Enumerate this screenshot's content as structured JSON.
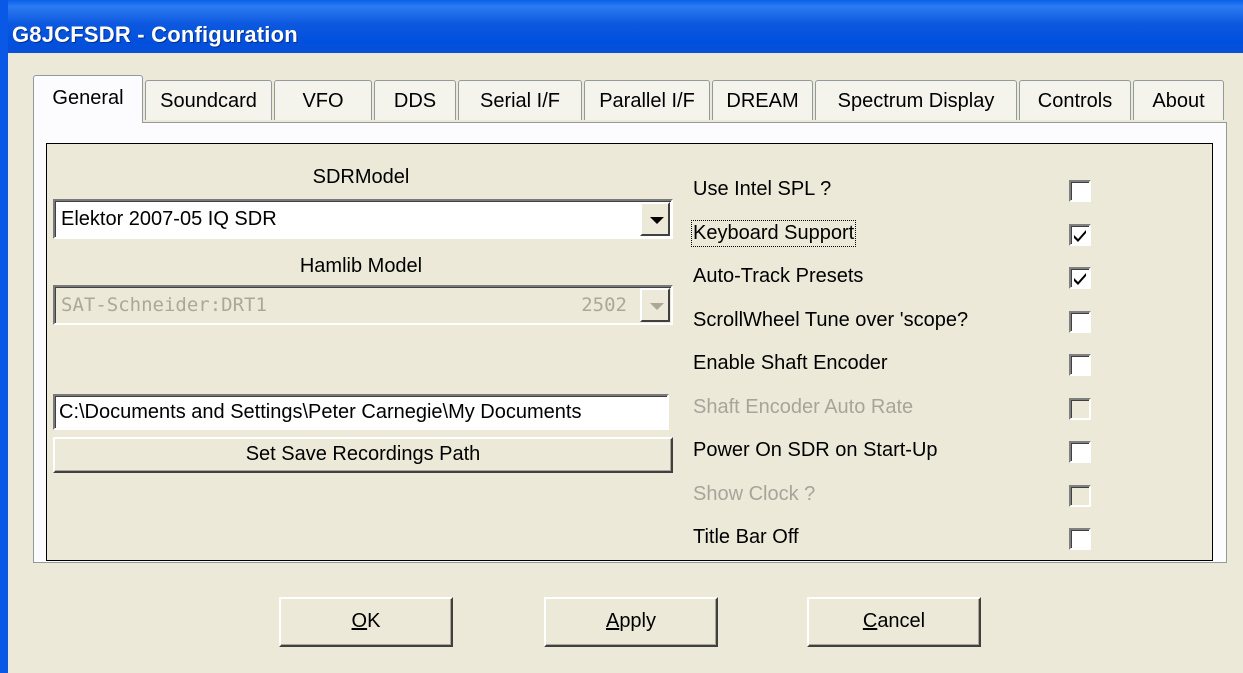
{
  "window": {
    "title": "G8JCFSDR - Configuration"
  },
  "tabs": [
    {
      "label": "General",
      "active": true
    },
    {
      "label": "Soundcard"
    },
    {
      "label": "VFO"
    },
    {
      "label": "DDS"
    },
    {
      "label": "Serial I/F"
    },
    {
      "label": "Parallel I/F"
    },
    {
      "label": "DREAM"
    },
    {
      "label": "Spectrum Display"
    },
    {
      "label": "Controls"
    },
    {
      "label": "About"
    }
  ],
  "general": {
    "sdr_model_label": "SDRModel",
    "sdr_model_value": "Elektor 2007-05 IQ SDR",
    "hamlib_label": "Hamlib Model",
    "hamlib_value": "SAT-Schneider:DRT1",
    "hamlib_number": "2502",
    "path_value": "C:\\Documents and Settings\\Peter Carnegie\\My Documents",
    "set_path_button": "Set Save Recordings Path"
  },
  "options": [
    {
      "label": "Use Intel SPL ?",
      "checked": false,
      "enabled": true
    },
    {
      "label": "Keyboard Support",
      "checked": true,
      "enabled": true,
      "focused": true
    },
    {
      "label": "Auto-Track Presets",
      "checked": true,
      "enabled": true
    },
    {
      "label": "ScrollWheel Tune over 'scope?",
      "checked": false,
      "enabled": true
    },
    {
      "label": "Enable Shaft Encoder",
      "checked": false,
      "enabled": true
    },
    {
      "label": "Shaft Encoder Auto Rate",
      "checked": false,
      "enabled": false
    },
    {
      "label": "Power On SDR on Start-Up",
      "checked": false,
      "enabled": true
    },
    {
      "label": "Show Clock ?",
      "checked": false,
      "enabled": false
    },
    {
      "label": "Title Bar Off",
      "checked": false,
      "enabled": true
    }
  ],
  "buttons": {
    "ok": {
      "mnemonic": "O",
      "rest": "K"
    },
    "apply": {
      "mnemonic": "A",
      "rest": "pply"
    },
    "cancel": {
      "mnemonic": "C",
      "rest": "ancel"
    }
  }
}
